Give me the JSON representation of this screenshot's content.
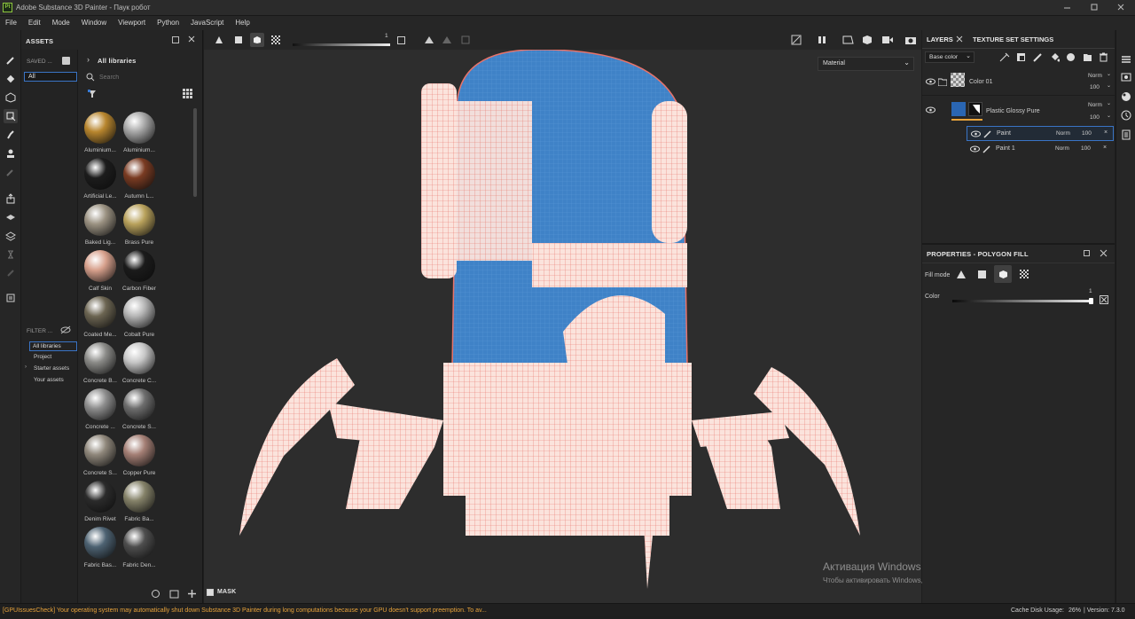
{
  "app": {
    "title": "Adobe Substance 3D Painter - Паук робот",
    "window_controls": [
      "minimize-icon",
      "maximize-icon",
      "close-icon"
    ]
  },
  "menu": [
    "File",
    "Edit",
    "Mode",
    "Window",
    "Viewport",
    "Python",
    "JavaScript",
    "Help"
  ],
  "assets": {
    "header": "ASSETS",
    "saved_label": "SAVED ...",
    "saved_filter": "All",
    "breadcrumb": "All libraries",
    "search_placeholder": "Search",
    "filter_label": "FILTER ...",
    "filter_items": [
      "All libraries",
      "Project",
      "Starter assets",
      "Your assets"
    ],
    "materials": [
      {
        "label": "Aluminium...",
        "color": "#b8862e"
      },
      {
        "label": "Aluminium...",
        "color": "#a7a7a7"
      },
      {
        "label": "Artificial Le...",
        "color": "#1c1c1c"
      },
      {
        "label": "Autumn L...",
        "color": "#7a3b22"
      },
      {
        "label": "Baked Lig...",
        "color": "#9b9282"
      },
      {
        "label": "Brass Pure",
        "color": "#b9a25c"
      },
      {
        "label": "Calf Skin",
        "color": "#d7a08c"
      },
      {
        "label": "Carbon Fiber",
        "color": "#1b1b1b"
      },
      {
        "label": "Coated Me...",
        "color": "#6c6552"
      },
      {
        "label": "Cobalt Pure",
        "color": "#b5b5b5"
      },
      {
        "label": "Concrete B...",
        "color": "#8b8b88"
      },
      {
        "label": "Concrete C...",
        "color": "#c7c7c7"
      },
      {
        "label": "Concrete ...",
        "color": "#8e8e8e"
      },
      {
        "label": "Concrete S...",
        "color": "#6e6e6e"
      },
      {
        "label": "Concrete S...",
        "color": "#8f877b"
      },
      {
        "label": "Copper Pure",
        "color": "#a47f75"
      },
      {
        "label": "Denim Rivet",
        "color": "#2b2b2b"
      },
      {
        "label": "Fabric Ba...",
        "color": "#858269"
      },
      {
        "label": "Fabric Bas...",
        "color": "#4d6272"
      },
      {
        "label": "Fabric Den...",
        "color": "#4e4e4e"
      }
    ]
  },
  "viewport": {
    "slider_value": "1",
    "material_mode": "Material",
    "mask_label": "MASK",
    "watermark_title": "Активация Windows",
    "watermark_body": "Чтобы активировать Windows, перейдите в раздел \"Параметры\"."
  },
  "layers": {
    "tab_layers": "LAYERS",
    "tab_texture": "TEXTURE SET SETTINGS",
    "channel": "Base color",
    "items": [
      {
        "name": "Color 01",
        "blend": "Norm",
        "opacity": "100"
      },
      {
        "name": "Plastic Glossy Pure",
        "blend": "Norm",
        "opacity": "100"
      }
    ],
    "sublayers": [
      {
        "name": "Paint",
        "blend": "Norm",
        "opacity": "100"
      },
      {
        "name": "Paint 1",
        "blend": "Norm",
        "opacity": "100"
      }
    ]
  },
  "properties": {
    "header": "PROPERTIES - POLYGON FILL",
    "fill_mode_label": "Fill mode",
    "color_label": "Color",
    "color_value": "1"
  },
  "status": {
    "message": "[GPUIssuesCheck] Your operating system may automatically shut down Substance 3D Painter during long computations because your GPU doesn't support preemption. To av...",
    "cache_label": "Cache Disk Usage:",
    "cache_value": "26%",
    "version": "| Version: 7.3.0"
  },
  "colors": {
    "accent_orange": "#e8a33b",
    "selection_blue": "#3a7bd5",
    "mesh_wire": "#e8736a",
    "mesh_blue": "#3f82c7"
  }
}
